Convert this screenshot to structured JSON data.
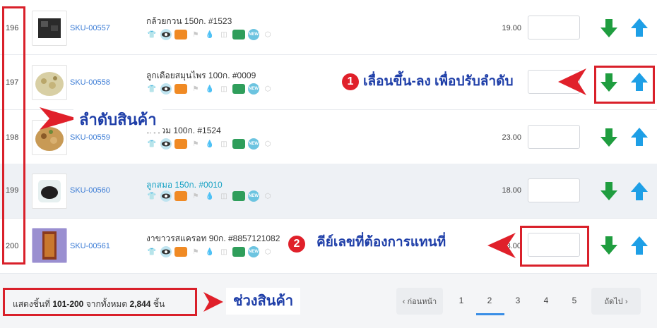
{
  "rows": [
    {
      "index": "196",
      "sku": "SKU-00557",
      "name": "กล้วยกวน 150ก. #1523",
      "price": "19.00"
    },
    {
      "index": "197",
      "sku": "SKU-00558",
      "name": "ลูกเดือยสมุนไพร 100ก. #0009",
      "price": ""
    },
    {
      "index": "198",
      "sku": "SKU-00559",
      "name": "ถั่วรวม 100ก. #1524",
      "price": "23.00"
    },
    {
      "index": "199",
      "sku": "SKU-00560",
      "name": "ลูกสมอ 150ก. #0010",
      "price": "18.00"
    },
    {
      "index": "200",
      "sku": "SKU-00561",
      "name": "งาขาวรสแครอท 90ก. #8857121082",
      "price": "23.00"
    }
  ],
  "annotations": {
    "order_label": "ลำดับสินค้า",
    "move_label": "เลื่อนขึ้น-ลง เพื่อปรับลำดับ",
    "move_number": "1",
    "key_label": "คีย์เลขที่ต้องการแทนที่",
    "key_number": "2",
    "range_label": "ช่วงสินค้า"
  },
  "status": {
    "prefix": "แสดงชิ้นที่ ",
    "range": "101-200",
    "middle": " จากทั้งหมด ",
    "total": "2,844",
    "suffix": " ชิ้น"
  },
  "pagination": {
    "prev_label": "‹ ก่อนหน้า",
    "next_label": "ถัดไป ›",
    "pages": [
      "1",
      "2",
      "3",
      "4",
      "5"
    ],
    "current": "2"
  },
  "icons": [
    "shirt-icon",
    "eye-icon",
    "box-icon",
    "flag-icon",
    "drop-icon",
    "cake-icon",
    "truck-icon",
    "new-icon",
    "tag-icon"
  ],
  "colors": {
    "arrow_down": "#1f9d3f",
    "arrow_up": "#1e9fe6",
    "annotation_red": "#d9202a",
    "annotation_text": "#1e3ea8",
    "link": "#3a7bd5"
  }
}
